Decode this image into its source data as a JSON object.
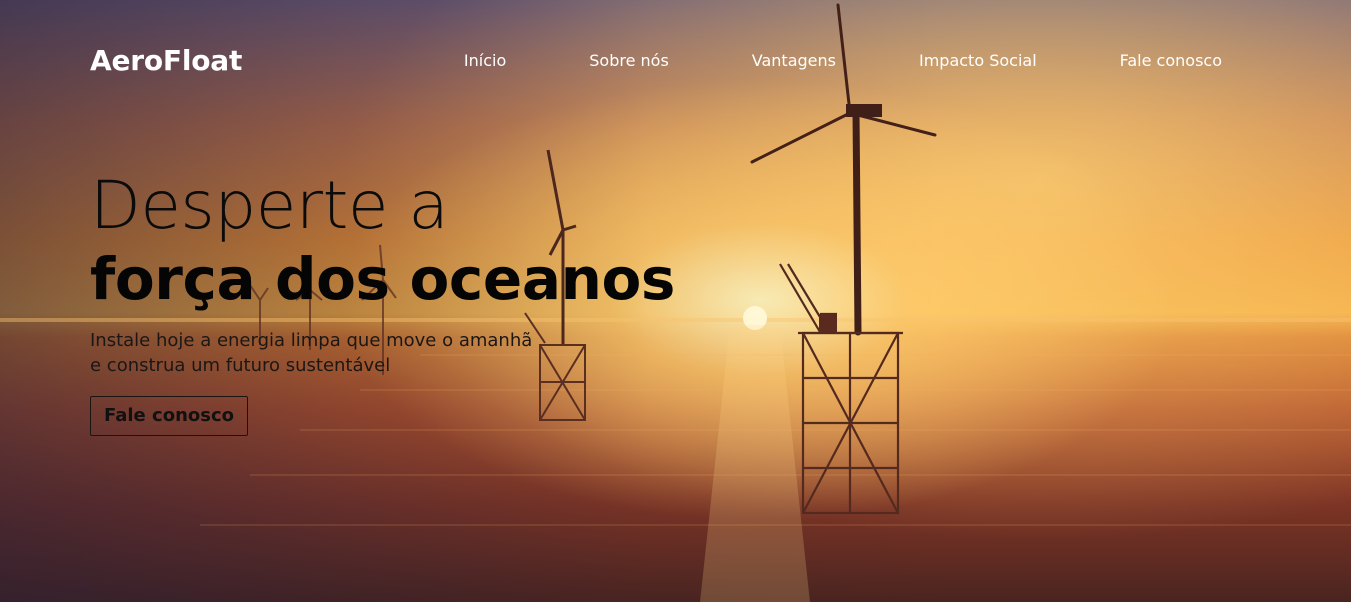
{
  "brand": {
    "name": "AeroFloat"
  },
  "nav": {
    "items": [
      {
        "label": "Início"
      },
      {
        "label": "Sobre nós"
      },
      {
        "label": "Vantagens"
      },
      {
        "label": "Impacto Social"
      },
      {
        "label": "Fale conosco"
      }
    ]
  },
  "hero": {
    "headline_line1": "Desperte a",
    "headline_line2": "força dos oceanos",
    "subtitle_line1": "Instale hoje a energia limpa que move o amanhã",
    "subtitle_line2": "e construa um futuro sustentável",
    "cta_label": "Fale conosco"
  },
  "colors": {
    "nav_text": "#ffffff",
    "headline_text": "#050505",
    "sky_gold": "#f2a942",
    "sea_deep": "#4a2420",
    "sun": "#fff4be"
  }
}
